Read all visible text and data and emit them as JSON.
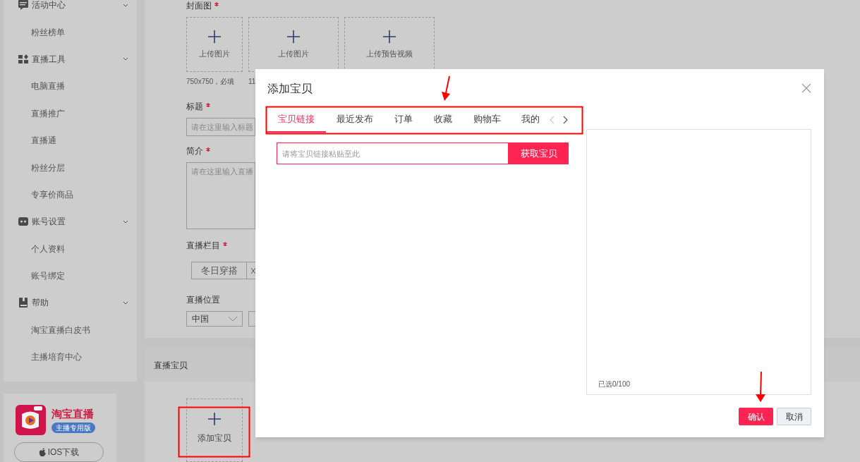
{
  "sidebar": {
    "groups": [
      {
        "label": "活动中心",
        "children": [
          {
            "label": "粉丝榜单"
          }
        ]
      },
      {
        "label": "直播工具",
        "children": [
          {
            "label": "电脑直播"
          },
          {
            "label": "直播推广"
          },
          {
            "label": "直播通"
          },
          {
            "label": "粉丝分层"
          },
          {
            "label": "专享价商品"
          }
        ]
      },
      {
        "label": "账号设置",
        "children": [
          {
            "label": "个人资料"
          },
          {
            "label": "账号绑定"
          }
        ]
      },
      {
        "label": "帮助",
        "children": [
          {
            "label": "淘宝直播白皮书"
          },
          {
            "label": "主播培育中心"
          }
        ]
      }
    ]
  },
  "app_card": {
    "name": "淘宝直播",
    "badge": "主播专用版",
    "download_button": "IOS下载"
  },
  "form": {
    "cover": {
      "label": "封面图",
      "required": true,
      "uploads": [
        {
          "label": "上传图片",
          "caption": "750x750，必填"
        },
        {
          "label": "上传图片",
          "caption": "11"
        },
        {
          "label": "上传预告视频"
        }
      ]
    },
    "title_field": {
      "label": "标题",
      "required": true,
      "placeholder": "请在这里输入标题"
    },
    "intro_field": {
      "label": "简介",
      "required": true,
      "placeholder": "请在这里输入直播"
    },
    "column": {
      "label": "直播栏目",
      "required": true,
      "tag": "冬日穿搭"
    },
    "location": {
      "label": "直播位置",
      "required": false,
      "value": "中国"
    }
  },
  "products_section": {
    "title": "直播宝贝",
    "add_button": "添加宝贝"
  },
  "dialog": {
    "title": "添加宝贝",
    "tabs": [
      {
        "label": "宝贝链接",
        "selected": true
      },
      {
        "label": "最近发布",
        "selected": false
      },
      {
        "label": "订单",
        "selected": false
      },
      {
        "label": "收藏",
        "selected": false
      },
      {
        "label": "购物车",
        "selected": false
      },
      {
        "label": "我的",
        "selected": false
      }
    ],
    "link_field": {
      "placeholder": "请将宝贝链接粘贴至此"
    },
    "fetch_button": "获取宝贝",
    "selected_count": "已选0/100",
    "buttons": [
      {
        "label": "确认",
        "kind": "primary"
      },
      {
        "label": "取消",
        "kind": "default"
      }
    ]
  }
}
